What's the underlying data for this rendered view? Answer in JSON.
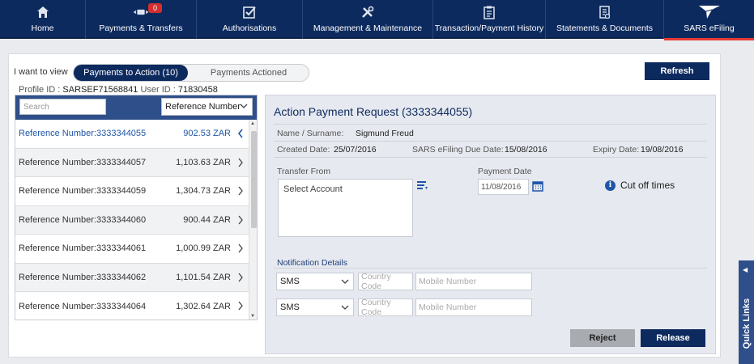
{
  "nav": {
    "items": [
      {
        "label": "Home",
        "icon": "home-icon"
      },
      {
        "label": "Payments & Transfers",
        "icon": "payments-icon"
      },
      {
        "label": "Authorisations",
        "icon": "authorisations-icon",
        "badge": "0"
      },
      {
        "label": "Management & Maintenance",
        "icon": "tools-icon"
      },
      {
        "label": "Transaction/Payment History",
        "icon": "clipboard-icon"
      },
      {
        "label": "Statements & Documents",
        "icon": "document-icon"
      },
      {
        "label": "SARS eFiling",
        "icon": "sars-logo",
        "active": true
      }
    ]
  },
  "view": {
    "label": "I want to view",
    "tab_on": "Payments to Action  (10)",
    "tab_off": "Payments Actioned",
    "refresh": "Refresh"
  },
  "profile": {
    "profile_label": "Profile ID :",
    "profile_id": "SARSEF71568841",
    "user_label": "User ID :",
    "user_id": "71830458"
  },
  "list": {
    "search_placeholder": "Search",
    "sort": "Reference Number",
    "rows": [
      {
        "ref": "Reference Number:3333344055",
        "amount": "902.53 ZAR"
      },
      {
        "ref": "Reference Number:3333344057",
        "amount": "1,103.63 ZAR"
      },
      {
        "ref": "Reference Number:3333344059",
        "amount": "1,304.73 ZAR"
      },
      {
        "ref": "Reference Number:3333344060",
        "amount": "900.44 ZAR"
      },
      {
        "ref": "Reference Number:3333344061",
        "amount": "1,000.99 ZAR"
      },
      {
        "ref": "Reference Number:3333344062",
        "amount": "1,101.54 ZAR"
      },
      {
        "ref": "Reference Number:3333344064",
        "amount": "1,302.64 ZAR"
      }
    ]
  },
  "detail": {
    "title": "Action Payment Request (3333344055)",
    "name_label": "Name / Surname:",
    "name": "Sigmund Freud",
    "created_label": "Created Date:",
    "created": "25/07/2016",
    "due_label": "SARS eFiling Due Date:",
    "due": "15/08/2016",
    "expiry_label": "Expiry Date:",
    "expiry": "19/08/2016",
    "transfer_label": "Transfer From",
    "account_placeholder": "Select Account",
    "payment_date_label": "Payment Date",
    "payment_date": "11/08/2016",
    "cutoff": "Cut off times",
    "notification_label": "Notification Details",
    "notif_type_1": "SMS",
    "notif_type_2": "SMS",
    "country_code_placeholder": "Country Code",
    "mobile_placeholder": "Mobile Number",
    "reject": "Reject",
    "release": "Release"
  },
  "quick_links": "Quick Links",
  "colors": {
    "nav_bg": "#0d2a5e",
    "accent_red": "#e53935",
    "link_blue": "#1f56a8",
    "panel_head": "#2e4f8a"
  }
}
